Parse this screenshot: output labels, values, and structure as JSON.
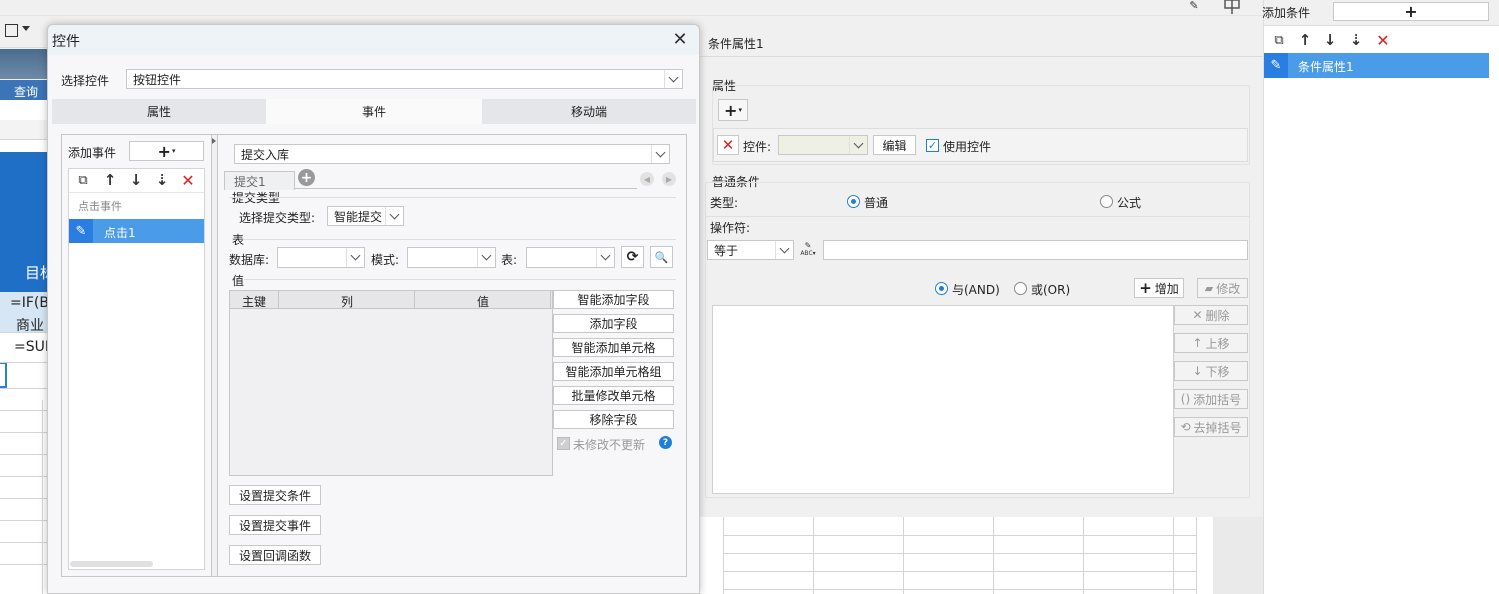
{
  "bg": {
    "query_label": "查询",
    "col_header": "目标",
    "formula1": "=IF(B",
    "formula2": "商业",
    "formula3": "=SUI"
  },
  "dialog": {
    "title": "控件",
    "select_label": "选择控件",
    "select_value": "按钮控件",
    "tabs": [
      "属性",
      "事件",
      "移动端"
    ],
    "add_event_label": "添加事件",
    "event_group": "点击事件",
    "event_item": "点击1",
    "action_value": "提交入库",
    "subtab": "提交1",
    "submit_type_section": "提交类型",
    "submit_type_label": "选择提交类型:",
    "submit_type_value": "智能提交",
    "table_section": "表",
    "db_label": "数据库:",
    "schema_label": "模式:",
    "table_label": "表:",
    "value_section": "值",
    "columns": [
      "主键",
      "列",
      "值"
    ],
    "right_buttons": [
      "智能添加字段",
      "添加字段",
      "智能添加单元格",
      "智能添加单元格组",
      "批量修改单元格",
      "移除字段"
    ],
    "no_update_label": "未修改不更新",
    "bottom_buttons": [
      "设置提交条件",
      "设置提交事件",
      "设置回调函数"
    ]
  },
  "cond": {
    "title": "条件属性1",
    "attr_section": "属性",
    "control_label": "控件:",
    "edit_button": "编辑",
    "use_control_label": "使用控件",
    "normal_section": "普通条件",
    "type_label": "类型:",
    "type_normal": "普通",
    "type_formula": "公式",
    "operator_label": "操作符:",
    "operator_value": "等于",
    "and_label": "与(AND)",
    "or_label": "或(OR)",
    "add_button": "增加",
    "modify_button": "修改",
    "side_buttons": [
      "删除",
      "上移",
      "下移",
      "添加括号",
      "去掉括号"
    ]
  },
  "right_panel": {
    "add_condition_label": "添加条件",
    "item": "条件属性1"
  }
}
